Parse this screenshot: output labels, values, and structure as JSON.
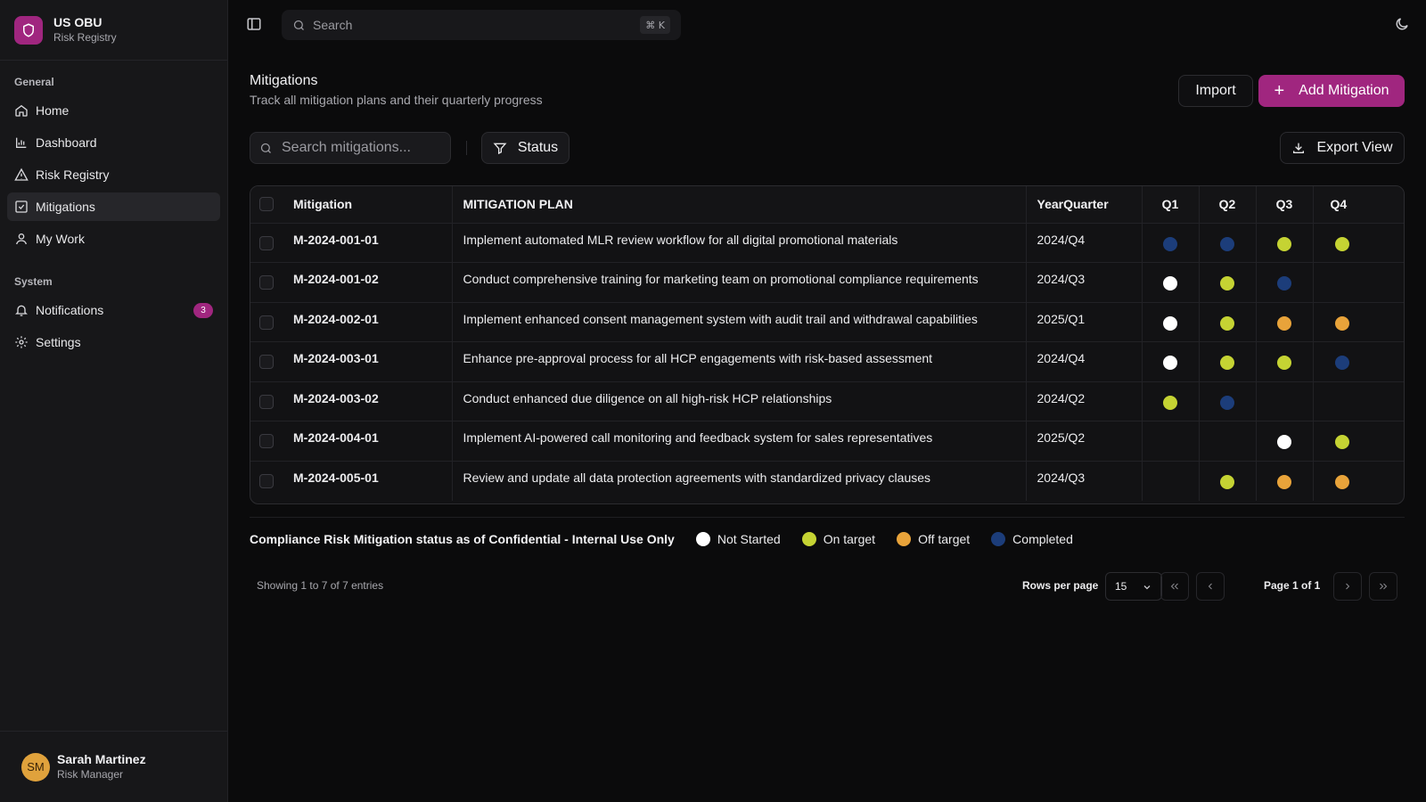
{
  "brand": {
    "title": "US OBU",
    "subtitle": "Risk Registry"
  },
  "sidebar": {
    "general_label": "General",
    "system_label": "System",
    "items": [
      {
        "label": "Home",
        "icon": "home-icon"
      },
      {
        "label": "Dashboard",
        "icon": "bar-chart-icon"
      },
      {
        "label": "Risk Registry",
        "icon": "warning-icon"
      },
      {
        "label": "Mitigations",
        "icon": "check-square-icon",
        "active": true
      },
      {
        "label": "My Work",
        "icon": "user-icon"
      }
    ],
    "system_items": [
      {
        "label": "Notifications",
        "icon": "bell-icon",
        "badge": "3"
      },
      {
        "label": "Settings",
        "icon": "gear-icon"
      }
    ]
  },
  "user": {
    "initials": "SM",
    "name": "Sarah Martinez",
    "role": "Risk Manager"
  },
  "topbar": {
    "search_placeholder": "Search",
    "shortcut": "⌘ K"
  },
  "page": {
    "title": "Mitigations",
    "subtitle": "Track all mitigation plans and their quarterly progress",
    "import_label": "Import",
    "add_label": "Add Mitigation",
    "export_label": "Export View",
    "search_placeholder": "Search mitigations...",
    "status_filter_label": "Status"
  },
  "table": {
    "columns": [
      "Mitigation",
      "MITIGATION PLAN",
      "YearQuarter",
      "Q1",
      "Q2",
      "Q3",
      "Q4"
    ],
    "rows": [
      {
        "id": "M-2024-001-01",
        "plan": "Implement automated MLR review workflow for all digital promotional materials",
        "yq": "2024/Q4",
        "q": [
          "completed",
          "completed",
          "on_target",
          "on_target"
        ]
      },
      {
        "id": "M-2024-001-02",
        "plan": "Conduct comprehensive training for marketing team on promotional compliance requirements",
        "yq": "2024/Q3",
        "q": [
          "not_started",
          "on_target",
          "completed",
          null
        ]
      },
      {
        "id": "M-2024-002-01",
        "plan": "Implement enhanced consent management system with audit trail and withdrawal capabilities",
        "yq": "2025/Q1",
        "q": [
          "not_started",
          "on_target",
          "off_target",
          "off_target"
        ]
      },
      {
        "id": "M-2024-003-01",
        "plan": "Enhance pre-approval process for all HCP engagements with risk-based assessment",
        "yq": "2024/Q4",
        "q": [
          "not_started",
          "on_target",
          "on_target",
          "completed"
        ]
      },
      {
        "id": "M-2024-003-02",
        "plan": "Conduct enhanced due diligence on all high-risk HCP relationships",
        "yq": "2024/Q2",
        "q": [
          "on_target",
          "completed",
          null,
          null
        ]
      },
      {
        "id": "M-2024-004-01",
        "plan": "Implement AI-powered call monitoring and feedback system for sales representatives",
        "yq": "2025/Q2",
        "q": [
          null,
          null,
          "not_started",
          "on_target"
        ]
      },
      {
        "id": "M-2024-005-01",
        "plan": "Review and update all data protection agreements with standardized privacy clauses",
        "yq": "2024/Q3",
        "q": [
          null,
          "on_target",
          "off_target",
          "off_target"
        ]
      }
    ]
  },
  "legend": {
    "title": "Compliance Risk Mitigation status as of Confidential - Internal Use Only",
    "items": [
      {
        "key": "not_started",
        "label": "Not Started"
      },
      {
        "key": "on_target",
        "label": "On target"
      },
      {
        "key": "off_target",
        "label": "Off target"
      },
      {
        "key": "completed",
        "label": "Completed"
      }
    ]
  },
  "status_colors": {
    "not_started": "#ffffff",
    "on_target": "#c5d333",
    "off_target": "#e8a33a",
    "completed": "#1c3d7a"
  },
  "footer": {
    "showing": "Showing 1 to 7 of 7 entries",
    "rows_per_page_label": "Rows per page",
    "rows_per_page": "15",
    "page_of": "Page 1 of 1"
  }
}
